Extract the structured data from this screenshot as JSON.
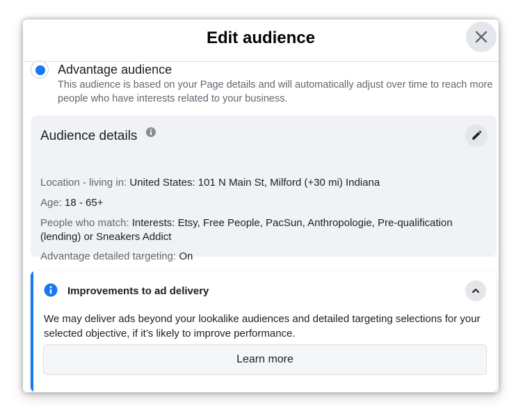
{
  "dialog": {
    "title": "Edit audience",
    "close_icon": "close-icon"
  },
  "option": {
    "selected": true,
    "title": "Advantage audience",
    "description": "This audience is based on your Page details and will automatically adjust over time to reach more people who have interests related to your business."
  },
  "details": {
    "title": "Audience details",
    "info_icon": "info-icon",
    "edit_icon": "pencil-icon",
    "rows": [
      {
        "label": "Location - living in: ",
        "value": "United States: 101 N Main St, Milford (+30 mi) Indiana"
      },
      {
        "label": "Age: ",
        "value": "18 - 65+"
      },
      {
        "label": "People who match: ",
        "value": "Interests: Etsy, Free People, PacSun, Anthropologie, Pre-qualification (lending) or Sneakers Addict"
      },
      {
        "label": "Advantage detailed targeting: ",
        "value": "On"
      }
    ]
  },
  "improvements": {
    "title": "Improvements to ad delivery",
    "icon": "info-icon",
    "collapse_icon": "chevron-up-icon",
    "text": "We may deliver ads beyond your lookalike audiences and detailed targeting selections for your selected objective, if it’s likely to improve performance.",
    "button_label": "Learn more"
  },
  "colors": {
    "accent": "#1877f2",
    "panel": "#f0f2f5",
    "secondary_text": "#606770"
  }
}
